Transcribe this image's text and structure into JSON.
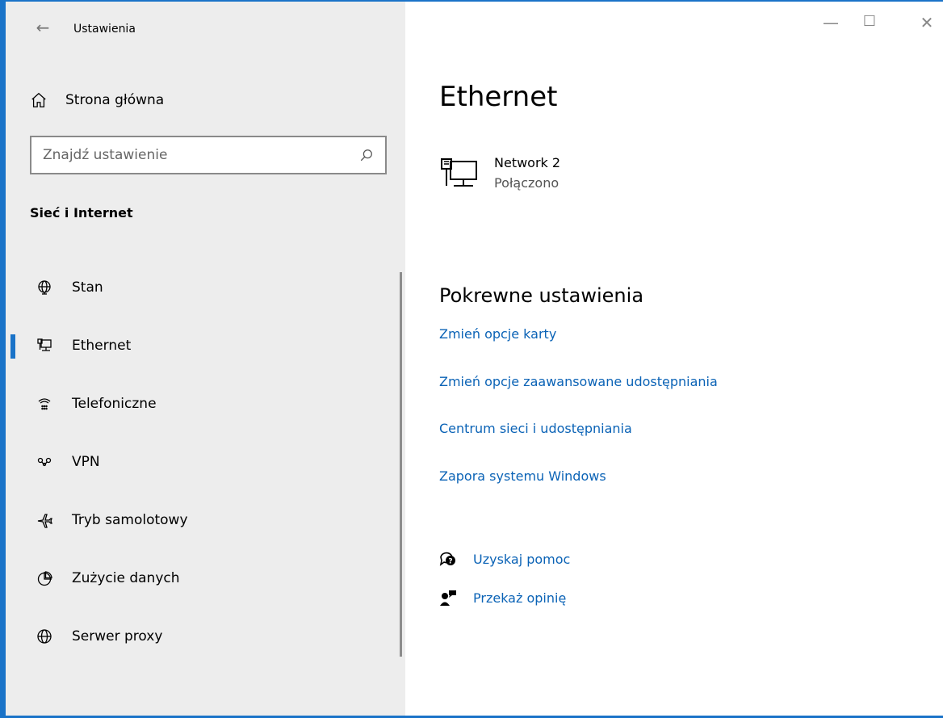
{
  "window": {
    "title": "Ustawienia",
    "accent": "#1a73c8",
    "controls": {
      "minimize": "—",
      "maximize": "☐",
      "close": "✕"
    }
  },
  "sidebar": {
    "home_label": "Strona główna",
    "search_placeholder": "Znajdź ustawienie",
    "section_title": "Sieć i Internet",
    "items": [
      {
        "label": "Stan",
        "icon": "globe-status-icon"
      },
      {
        "label": "Ethernet",
        "icon": "ethernet-icon",
        "active": true
      },
      {
        "label": "Telefoniczne",
        "icon": "dialup-icon"
      },
      {
        "label": "VPN",
        "icon": "vpn-icon"
      },
      {
        "label": "Tryb samolotowy",
        "icon": "airplane-icon"
      },
      {
        "label": "Zużycie danych",
        "icon": "data-usage-icon"
      },
      {
        "label": "Serwer proxy",
        "icon": "globe-icon"
      }
    ]
  },
  "main": {
    "title": "Ethernet",
    "network": {
      "name": "Network 2",
      "status": "Połączono"
    },
    "related": {
      "title": "Pokrewne ustawienia",
      "links": [
        "Zmień opcje karty",
        "Zmień opcje zaawansowane udostępniania",
        "Centrum sieci i udostępniania",
        "Zapora systemu Windows"
      ]
    },
    "help": {
      "get_help": "Uzyskaj pomoc",
      "feedback": "Przekaż opinię"
    }
  }
}
